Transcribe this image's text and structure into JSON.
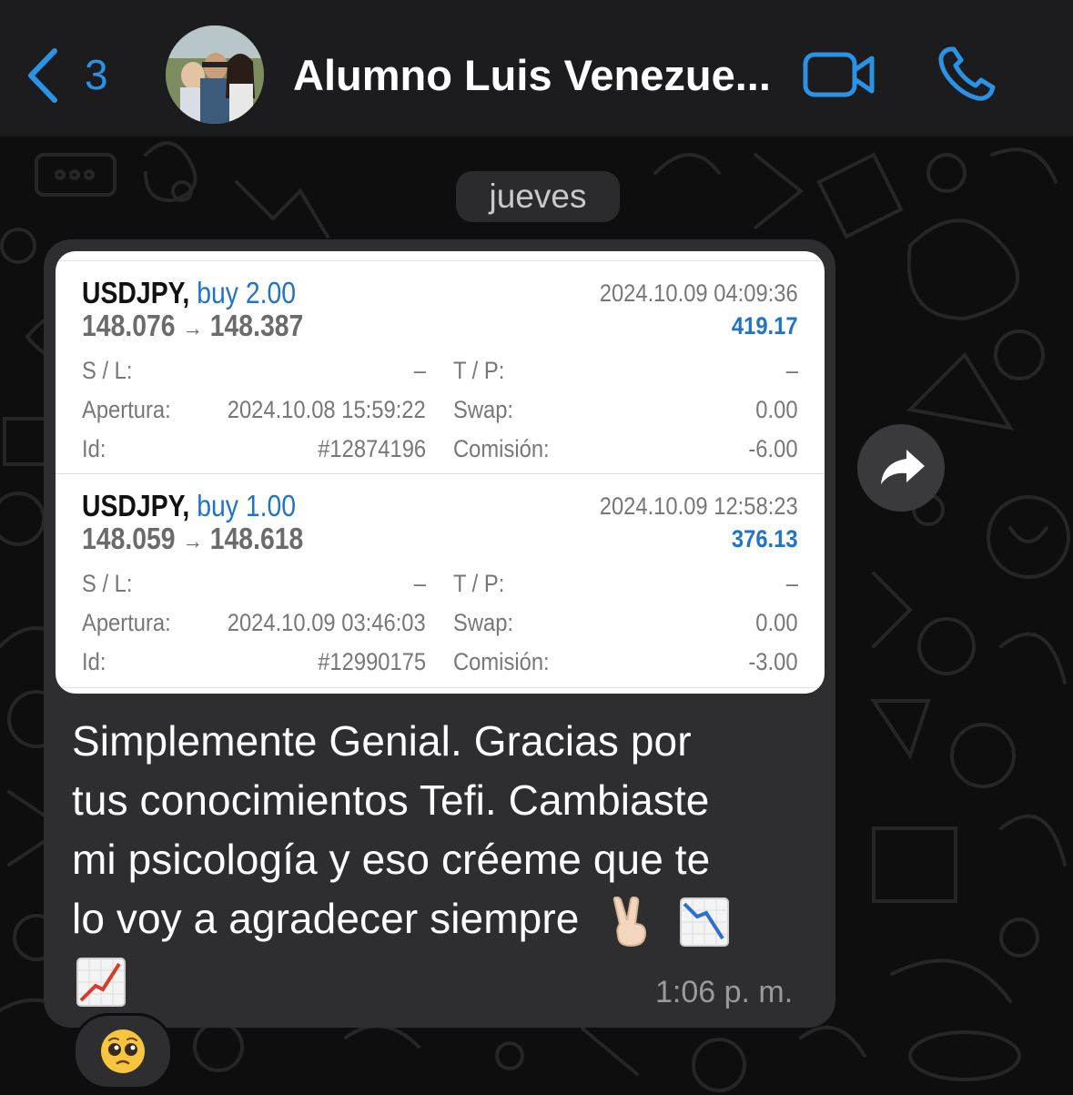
{
  "header": {
    "back_count": "3",
    "contact_name": "Alumno Luis Venezue..."
  },
  "chat": {
    "date_label": "jueves",
    "trades": [
      {
        "symbol": "USDJPY,",
        "action": "buy 2.00",
        "open_price": "148.076",
        "arrow": "→",
        "close_price": "148.387",
        "close_time": "2024.10.09 04:09:36",
        "profit": "419.17",
        "sl_label": "S / L:",
        "sl_value": "–",
        "tp_label": "T / P:",
        "tp_value": "–",
        "open_label": "Apertura:",
        "open_time": "2024.10.08 15:59:22",
        "swap_label": "Swap:",
        "swap_value": "0.00",
        "id_label": "Id:",
        "id_value": "#12874196",
        "commission_label": "Comisión:",
        "commission_value": "-6.00"
      },
      {
        "symbol": "USDJPY,",
        "action": "buy 1.00",
        "open_price": "148.059",
        "arrow": "→",
        "close_price": "148.618",
        "close_time": "2024.10.09 12:58:23",
        "profit": "376.13",
        "sl_label": "S / L:",
        "sl_value": "–",
        "tp_label": "T / P:",
        "tp_value": "–",
        "open_label": "Apertura:",
        "open_time": "2024.10.09 03:46:03",
        "swap_label": "Swap:",
        "swap_value": "0.00",
        "id_label": "Id:",
        "id_value": "#12990175",
        "commission_label": "Comisión:",
        "commission_value": "-3.00"
      }
    ],
    "message_lines": [
      "Simplemente Genial. Gracias por",
      "tus conocimientos Tefi. Cambiaste",
      "mi psicología y eso créeme que te",
      "lo voy a agradecer siempre"
    ],
    "message_time": "1:06 p. m.",
    "reaction_emoji": "pleading-face",
    "inline_emojis": [
      "victory-hand",
      "chart-decreasing",
      "chart-increasing"
    ]
  },
  "colors": {
    "accent": "#2a93e6",
    "action_blue": "#1f74c8",
    "bubble": "#2e2e30",
    "header": "#1c1c1e"
  }
}
